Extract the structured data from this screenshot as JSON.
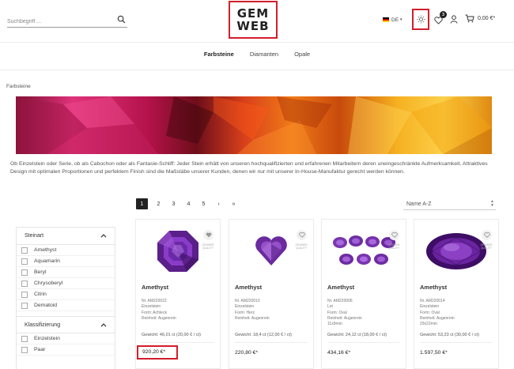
{
  "header": {
    "search_placeholder": "Suchbegriff ...",
    "logo_line1": "GEM",
    "logo_line2": "WEB",
    "language": "DE",
    "wishlist_count": "3",
    "cart_total": "0,00 €*"
  },
  "nav": {
    "items": [
      {
        "label": "Farbsteine"
      },
      {
        "label": "Diamanten"
      },
      {
        "label": "Opale"
      }
    ]
  },
  "breadcrumb": "Farbsteine",
  "intro_text": "Ob Einzelstein oder Serie, ob als Cabochon oder als Fantasie-Schliff: Jeder Stein erhält von unseren hochqualifizierten und erfahrenen Mitarbeitern deren uneingeschränkte Aufmerksamkeit. Attraktives Design mit optimalen Proportionen und perfektem Finish sind die Maßstäbe unserer Kunden, denen wir nur mit unserer In-House-Manufaktur gerecht werden können.",
  "pagination": {
    "pages": [
      "1",
      "2",
      "3",
      "4",
      "5"
    ],
    "next": "›",
    "last": "»"
  },
  "sort": {
    "selected": "Name A-Z"
  },
  "filter": {
    "group1_title": "Steinart",
    "group1_items": [
      "Amethyst",
      "Aquamarin",
      "Beryl",
      "Chrysoberyl",
      "Citrin",
      "Dematoid"
    ],
    "group2_title": "Klassifizierung",
    "group2_items": [
      "Einzelstein",
      "Paar"
    ]
  },
  "products": [
    {
      "name": "Amethyst",
      "number": "Nr. AM220022",
      "type": "Einzelstein",
      "form": "Form: Achteck",
      "purity": "Reinheit: Augenrein",
      "size": "",
      "weight": "Gewicht: 46,01 ct (20,00 € / ct)",
      "price": "920,20 €*",
      "stamp": "GEMWEB QUALITY"
    },
    {
      "name": "Amethyst",
      "number": "Nr. AM220010",
      "type": "Einzelstein",
      "form": "Form: Herz",
      "purity": "Reinheit: Augenrein",
      "size": "",
      "weight": "Gewicht: 18,4 ct (12,00 € / ct)",
      "price": "220,80 €*",
      "stamp": "GEMWEB QUALITY"
    },
    {
      "name": "Amethyst",
      "number": "Nr. AM220006",
      "type": "Lot",
      "form": "Form: Oval",
      "purity": "Reinheit: Augenrein",
      "size": "11x9mm",
      "weight": "Gewicht: 24,12 ct (18,00 € / ct)",
      "price": "434,16 €*",
      "stamp": "GEMWEB QUALITY"
    },
    {
      "name": "Amethyst",
      "number": "Nr. AM220014",
      "type": "Einzelstein",
      "form": "Form: Oval",
      "purity": "Reinheit: Augenrein",
      "size": "29x22mm",
      "weight": "Gewicht: 53,23 ct (30,00 € / ct)",
      "price": "1.597,50 €*",
      "stamp": "GEMWEB QUALITY"
    }
  ],
  "colors": {
    "highlight": "#d21e2b",
    "amethyst": "#6a2a9c",
    "ruby": "#c81b5b",
    "orange": "#e2560f",
    "yellow": "#f3b41a"
  }
}
